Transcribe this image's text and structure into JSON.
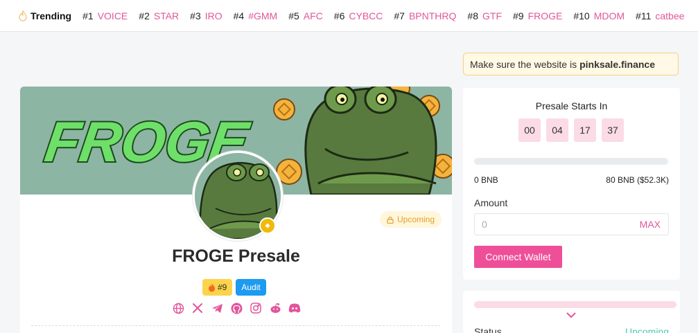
{
  "trending": {
    "title": "Trending",
    "items": [
      {
        "rank": "#1",
        "name": "VOICE"
      },
      {
        "rank": "#2",
        "name": "STAR"
      },
      {
        "rank": "#3",
        "name": "IRO"
      },
      {
        "rank": "#4",
        "name": "#GMM"
      },
      {
        "rank": "#5",
        "name": "AFC"
      },
      {
        "rank": "#6",
        "name": "CYBCC"
      },
      {
        "rank": "#7",
        "name": "BPNTHRQ"
      },
      {
        "rank": "#8",
        "name": "GTF"
      },
      {
        "rank": "#9",
        "name": "FROGE"
      },
      {
        "rank": "#10",
        "name": "MDOM"
      },
      {
        "rank": "#11",
        "name": "catbee"
      }
    ]
  },
  "banner": {
    "brand_text": "FROGE"
  },
  "project": {
    "title": "FROGE Presale",
    "status": "Upcoming",
    "trend_badge": "#9",
    "audit_label": "Audit",
    "socials": [
      "globe-icon",
      "x-icon",
      "telegram-icon",
      "github-icon",
      "instagram-icon",
      "reddit-icon",
      "discord-icon"
    ]
  },
  "warning": {
    "text": "Make sure the website is",
    "domain": "pinksale.finance"
  },
  "sale": {
    "starts_label": "Presale Starts In",
    "countdown": [
      "00",
      "04",
      "17",
      "37"
    ],
    "progress_fraction": 0,
    "min_label": "0 BNB",
    "max_label": "80 BNB ($52.3K)",
    "amount_label": "Amount",
    "amount_placeholder": "0",
    "max_button": "MAX",
    "connect_button": "Connect Wallet"
  },
  "info": {
    "status_label": "Status",
    "status_value": "Upcoming"
  },
  "colors": {
    "accent": "#e1559c",
    "button": "#ef4f99",
    "upcoming": "#e0a12a",
    "audit": "#1d9bf0",
    "status_green": "#4ec7b0"
  }
}
